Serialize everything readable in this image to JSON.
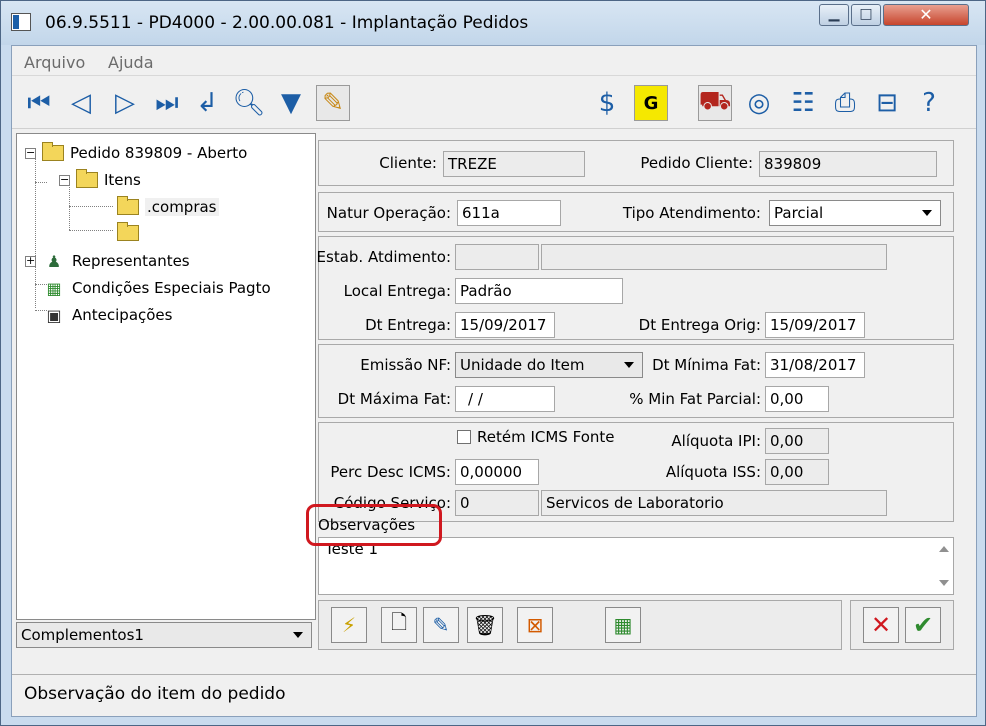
{
  "window": {
    "title": "06.9.5511 - PD4000 - 2.00.00.081 - Implantação Pedidos"
  },
  "menu": {
    "items": [
      "Arquivo",
      "Ajuda"
    ]
  },
  "toolbar": {
    "icons": [
      "first-icon",
      "prev-icon",
      "next-icon",
      "last-icon",
      "return-icon",
      "zoom-icon",
      "filter-icon",
      "edit-document-icon",
      "price-icon",
      "g-icon",
      "truck-icon",
      "target-icon",
      "tree-structure-icon",
      "print-icon",
      "exit-icon",
      "help-icon"
    ]
  },
  "tree": {
    "root": "Pedido 839809 - Aberto",
    "itens": "Itens",
    "compras": ".compras",
    "representantes": "Representantes",
    "condicoes": "Condições Especiais Pagto",
    "antecipacoes": "Antecipações"
  },
  "complementos": {
    "value": "Complementos1"
  },
  "form": {
    "cliente_label": "Cliente:",
    "cliente_value": "TREZE",
    "pedido_cliente_label": "Pedido Cliente:",
    "pedido_cliente_value": "839809",
    "natur_label": "Natur Operação:",
    "natur_value": "611a",
    "tipo_atend_label": "Tipo Atendimento:",
    "tipo_atend_value": "Parcial",
    "estab_label": "Estab. Atdimento:",
    "local_label": "Local Entrega:",
    "local_value": "Padrão",
    "dt_entrega_label": "Dt Entrega:",
    "dt_entrega_value": "15/09/2017",
    "dt_entrega_orig_label": "Dt Entrega Orig:",
    "dt_entrega_orig_value": "15/09/2017",
    "emissao_label": "Emissão NF:",
    "emissao_value": "Unidade do Item",
    "dt_min_label": "Dt Mínima Fat:",
    "dt_min_value": "31/08/2017",
    "dt_max_label": "Dt Máxima Fat:",
    "dt_max_value": "/ /",
    "min_fat_label": "% Min Fat Parcial:",
    "min_fat_value": "0,00",
    "retem_label": "Retém ICMS Fonte",
    "aliq_ipi_label": "Alíquota IPI:",
    "aliq_ipi_value": "0,00",
    "perc_desc_label": "Perc Desc ICMS:",
    "perc_desc_value": "0,00000",
    "aliq_iss_label": "Alíquota ISS:",
    "aliq_iss_value": "0,00",
    "codigo_label": "Código Serviço:",
    "codigo_value": "0",
    "codigo_desc": "Servicos de Laboratorio",
    "obs_label": "Observações",
    "obs_value": "Teste 1"
  },
  "status": {
    "text": "Observação do item do pedido"
  },
  "colors": {
    "annotation": "#d0181f",
    "title_bar": "#c9dbee",
    "accent_icon": "#1d5ea6"
  }
}
